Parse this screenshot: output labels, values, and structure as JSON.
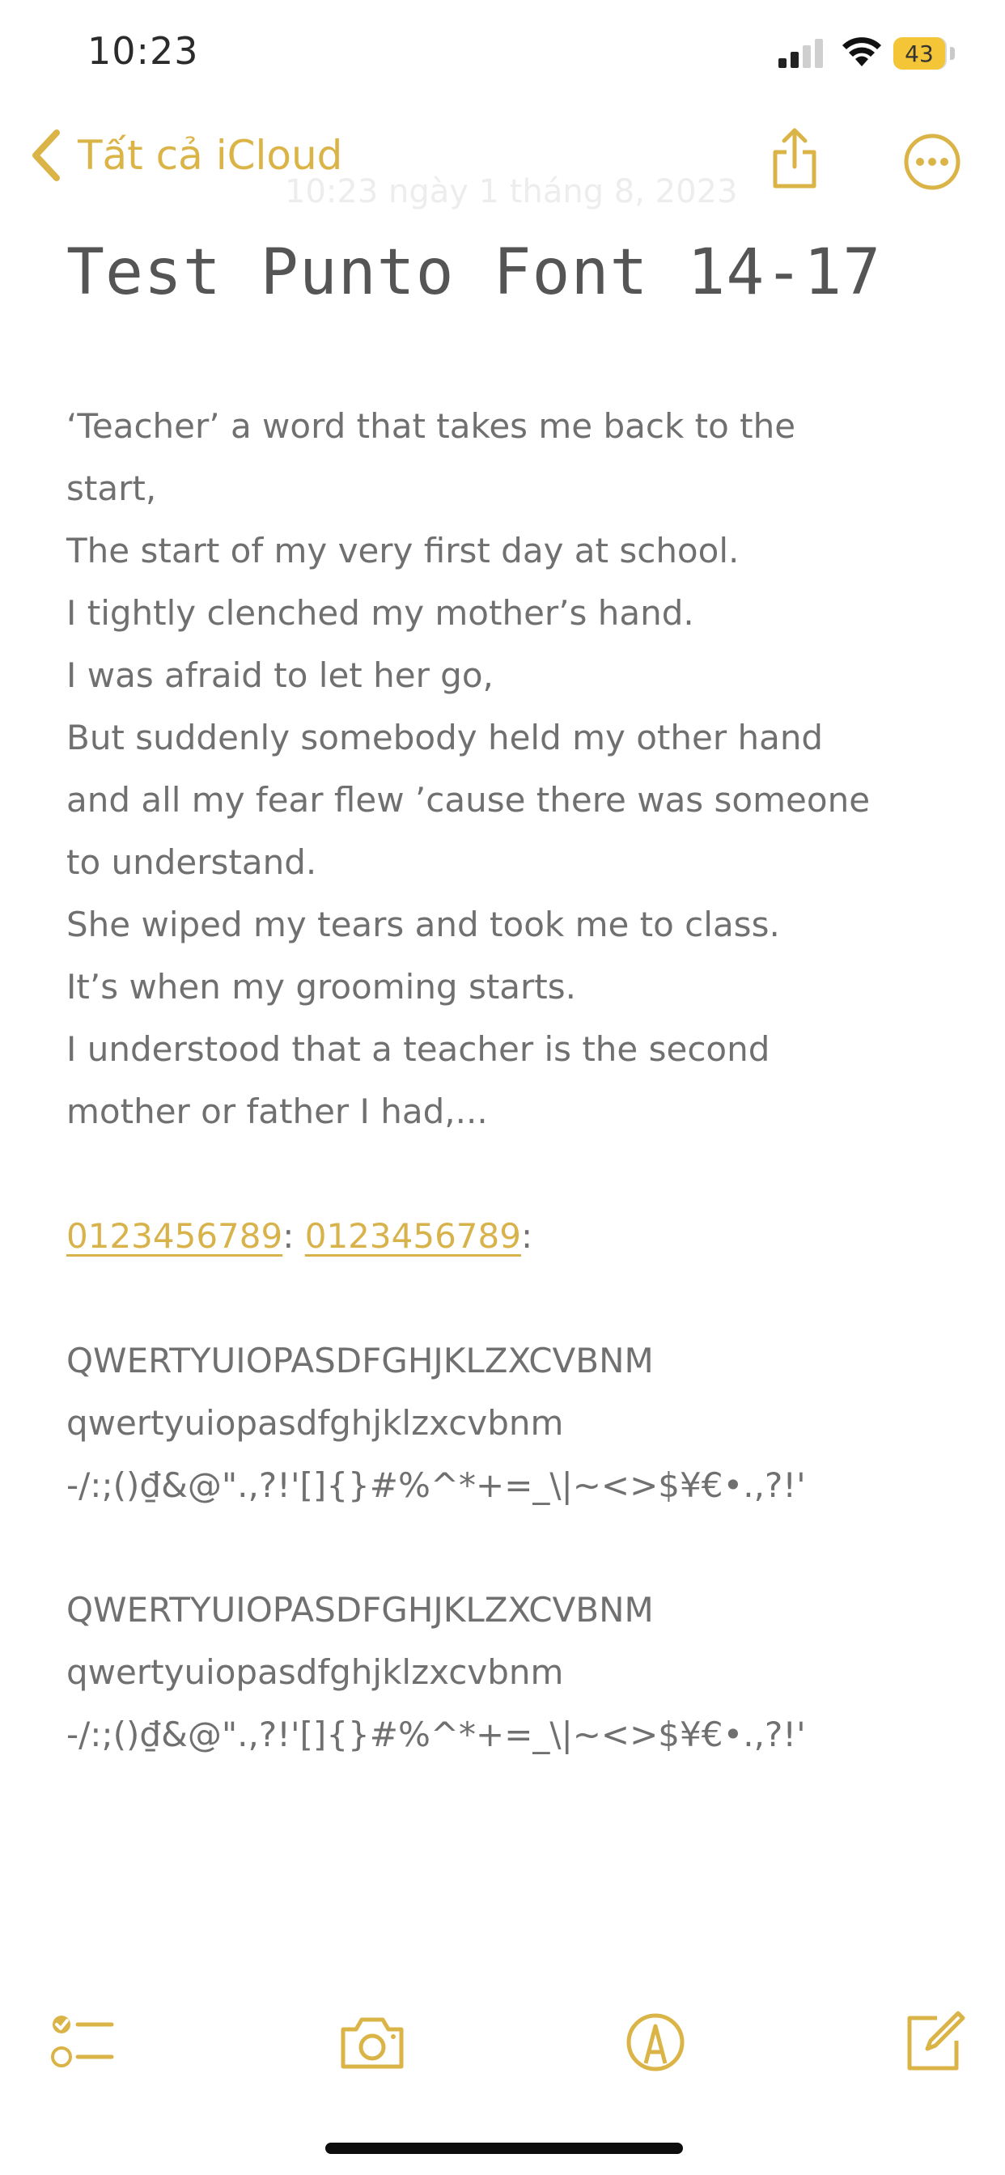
{
  "status_bar": {
    "time": "10:23",
    "battery": "43"
  },
  "nav": {
    "back_label": "Tất cả iCloud",
    "faded_date": "10:23 ngày 1 tháng 8, 2023"
  },
  "note": {
    "title": "Test Punto Font 14-17",
    "lines": [
      "‘Teacher’ a word that takes me back to the",
      "start,",
      "The start of my very first day at school.",
      "I tightly clenched my mother’s hand.",
      "I was afraid to let her go,",
      "But suddenly somebody held my other hand",
      "and all my fear flew ’cause there was someone",
      "to understand.",
      "She wiped my tears and took me to class.",
      "It’s when my grooming starts.",
      "I understood that a teacher is the second",
      "mother or father I had,..."
    ],
    "phone_link_1": "0123456789",
    "phone_link_2": "0123456789",
    "separator": ":",
    "trailing": ":",
    "charset_block_1": {
      "upper": "QWERTYUIOPASDFGHJKLZXCVBNM",
      "lower": "qwertyuiopasdfghjklzxcvbnm",
      "symbols": "-/:;()₫&@\".,?!'[]{}#%^*+=_\\|~<>$¥€•.,?!'"
    },
    "charset_block_2": {
      "upper": "QWERTYUIOPASDFGHJKLZXCVBNM",
      "lower": "qwertyuiopasdfghjklzxcvbnm",
      "symbols": "-/:;()₫&@\".,?!'[]{}#%^*+=_\\|~<>$¥€•.,?!'"
    }
  },
  "colors": {
    "accent": "#dbb448",
    "text": "#707070",
    "battery": "#f4c537"
  },
  "icons": [
    "chevron-left-icon",
    "share-icon",
    "more-icon",
    "checklist-icon",
    "camera-icon",
    "markup-icon",
    "compose-icon"
  ]
}
